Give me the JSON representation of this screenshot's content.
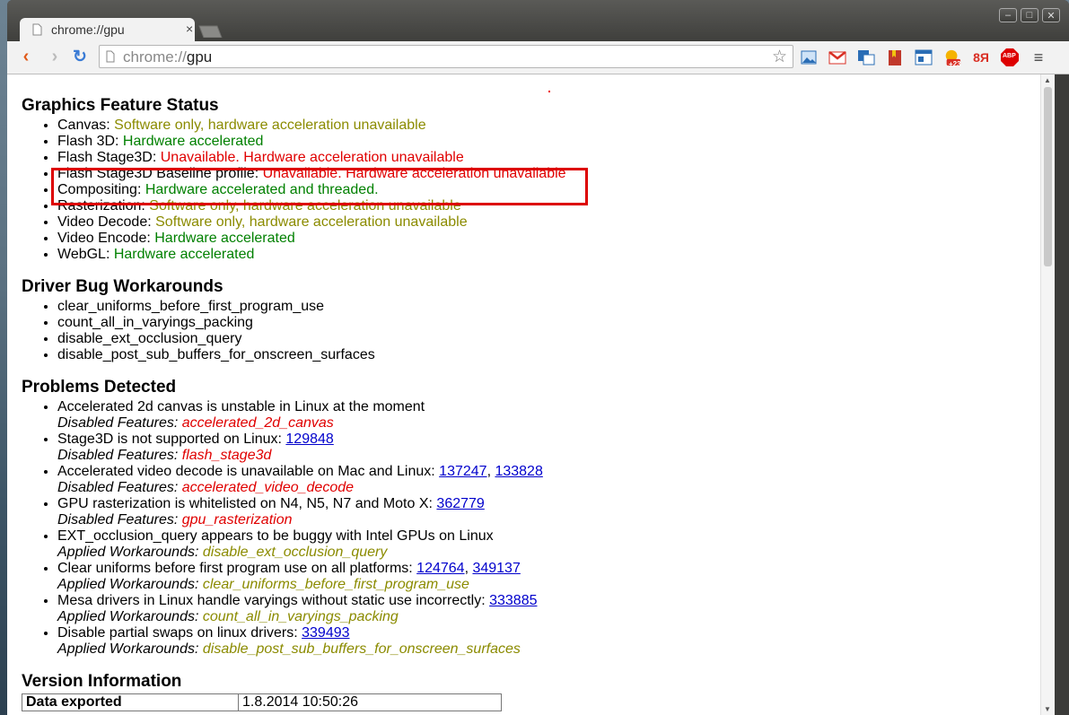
{
  "tab": {
    "title": "chrome://gpu",
    "close_glyph": "×"
  },
  "window_buttons": {
    "minimize": "–",
    "maximize": "□",
    "close": "✕"
  },
  "omnibox": {
    "scheme": "chrome://",
    "host": "gpu"
  },
  "extensions": [
    {
      "name": "image-icon",
      "color": "#2a6db5"
    },
    {
      "name": "gmail-icon",
      "color": "#d93025"
    },
    {
      "name": "translate-icon",
      "color": "#2a6db5"
    },
    {
      "name": "bookmark-icon",
      "color": "#c0392b"
    },
    {
      "name": "window-icon",
      "color": "#2a6db5"
    },
    {
      "name": "weather-icon",
      "color": "#f5b300",
      "badge": "+23"
    },
    {
      "name": "yandex-icon",
      "label": "8Я",
      "color": "#d93025"
    },
    {
      "name": "adblock-icon",
      "label": "ABP",
      "color": "#d00"
    }
  ],
  "sections": {
    "features": {
      "title": "Graphics Feature Status",
      "items": [
        {
          "name": "Canvas",
          "status": "Software only, hardware acceleration unavailable",
          "kind": "sw"
        },
        {
          "name": "Flash 3D",
          "status": "Hardware accelerated",
          "kind": "hw"
        },
        {
          "name": "Flash Stage3D",
          "status": "Unavailable. Hardware acceleration unavailable",
          "kind": "un"
        },
        {
          "name": "Flash Stage3D Baseline profile",
          "status": "Unavailable. Hardware acceleration unavailable",
          "kind": "un"
        },
        {
          "name": "Compositing",
          "status": "Hardware accelerated and threaded.",
          "kind": "hw"
        },
        {
          "name": "Rasterization",
          "status": "Software only, hardware acceleration unavailable",
          "kind": "sw"
        },
        {
          "name": "Video Decode",
          "status": "Software only, hardware acceleration unavailable",
          "kind": "sw"
        },
        {
          "name": "Video Encode",
          "status": "Hardware accelerated",
          "kind": "hw"
        },
        {
          "name": "WebGL",
          "status": "Hardware accelerated",
          "kind": "hw"
        }
      ]
    },
    "workarounds": {
      "title": "Driver Bug Workarounds",
      "items": [
        "clear_uniforms_before_first_program_use",
        "count_all_in_varyings_packing",
        "disable_ext_occlusion_query",
        "disable_post_sub_buffers_for_onscreen_surfaces"
      ]
    },
    "problems": {
      "title": "Problems Detected",
      "items": [
        {
          "text": "Accelerated 2d canvas is unstable in Linux at the moment",
          "links": [],
          "label": "Disabled Features:",
          "value": "accelerated_2d_canvas",
          "kind": "feat"
        },
        {
          "text": "Stage3D is not supported on Linux:",
          "links": [
            "129848"
          ],
          "label": "Disabled Features:",
          "value": "flash_stage3d",
          "kind": "feat"
        },
        {
          "text": "Accelerated video decode is unavailable on Mac and Linux:",
          "links": [
            "137247",
            "133828"
          ],
          "label": "Disabled Features:",
          "value": "accelerated_video_decode",
          "kind": "feat"
        },
        {
          "text": "GPU rasterization is whitelisted on N4, N5, N7 and Moto X:",
          "links": [
            "362779"
          ],
          "label": "Disabled Features:",
          "value": "gpu_rasterization",
          "kind": "feat"
        },
        {
          "text": "EXT_occlusion_query appears to be buggy with Intel GPUs on Linux",
          "links": [],
          "label": "Applied Workarounds:",
          "value": "disable_ext_occlusion_query",
          "kind": "wa"
        },
        {
          "text": "Clear uniforms before first program use on all platforms:",
          "links": [
            "124764",
            "349137"
          ],
          "label": "Applied Workarounds:",
          "value": "clear_uniforms_before_first_program_use",
          "kind": "wa"
        },
        {
          "text": "Mesa drivers in Linux handle varyings without static use incorrectly:",
          "links": [
            "333885"
          ],
          "label": "Applied Workarounds:",
          "value": "count_all_in_varyings_packing",
          "kind": "wa"
        },
        {
          "text": "Disable partial swaps on linux drivers:",
          "links": [
            "339493"
          ],
          "label": "Applied Workarounds:",
          "value": "disable_post_sub_buffers_for_onscreen_surfaces",
          "kind": "wa"
        }
      ]
    },
    "version": {
      "title": "Version Information",
      "rows": [
        {
          "key": "Data exported",
          "value": "1.8.2014 10:50:26"
        }
      ]
    }
  },
  "colors": {
    "software": "#8b8b00",
    "hardware": "#008000",
    "unavailable": "#e00000",
    "highlight": "#dd0000"
  }
}
